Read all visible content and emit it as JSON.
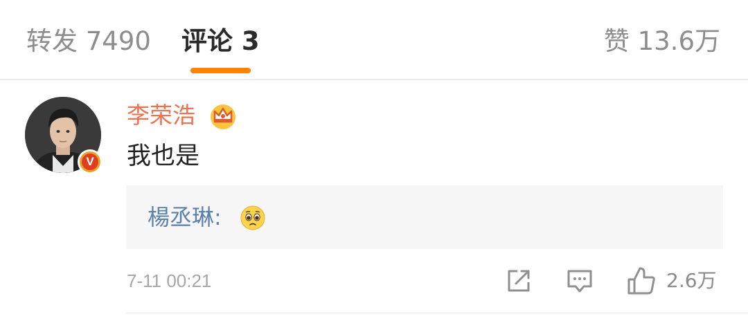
{
  "tabs": {
    "repost": "转发 7490",
    "comments": "评论 3",
    "likes": "赞 13.6万",
    "active": "comments",
    "accent_color": "#ff8200"
  },
  "comment": {
    "username": "李荣浩",
    "username_color": "#eb7350",
    "badges": [
      "crown-icon",
      "verified-v-icon"
    ],
    "text": "我也是",
    "reply": {
      "author": "楊丞琳:",
      "author_color": "#5c80ac",
      "emoji": "pleading-face-icon"
    },
    "timestamp": "7-11 00:21",
    "actions": {
      "share_icon": "share-icon",
      "comment_icon": "comment-icon",
      "like_icon": "thumbs-up-icon",
      "like_count": "2.6万"
    }
  }
}
